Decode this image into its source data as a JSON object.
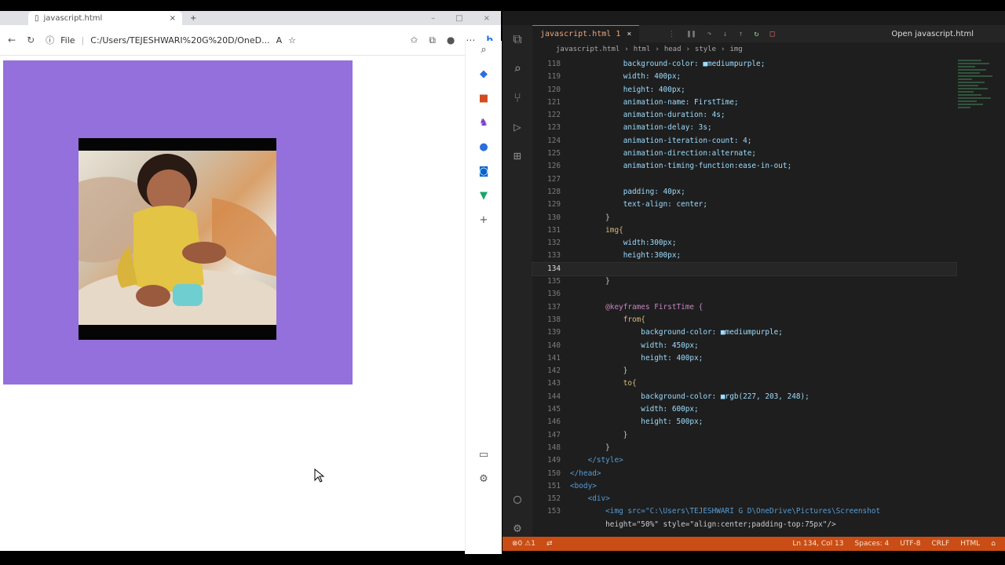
{
  "browser": {
    "tab_title": "javascript.html",
    "tab_close": "×",
    "new_tab": "+",
    "address_prefix": "File",
    "address_url": "C:/Users/TEJESHWARI%20G%20D/OneD...",
    "page_bg": "#9370db"
  },
  "editor": {
    "tab_title": "javascript.html 1",
    "tab_close": "×",
    "open_button": "Open javascript.html",
    "breadcrumbs": [
      "javascript.html",
      "html",
      "head",
      "style",
      "img"
    ],
    "lines": [
      {
        "n": "118",
        "t": "            background-color: ■mediumpurple;"
      },
      {
        "n": "119",
        "t": "            width: 400px;"
      },
      {
        "n": "120",
        "t": "            height: 400px;"
      },
      {
        "n": "121",
        "t": "            animation-name: FirstTime;"
      },
      {
        "n": "122",
        "t": "            animation-duration: 4s;"
      },
      {
        "n": "123",
        "t": "            animation-delay: 3s;"
      },
      {
        "n": "124",
        "t": "            animation-iteration-count: 4;"
      },
      {
        "n": "125",
        "t": "            animation-direction:alternate;"
      },
      {
        "n": "126",
        "t": "            animation-timing-function:ease-in-out;"
      },
      {
        "n": "127",
        "t": ""
      },
      {
        "n": "128",
        "t": "            padding: 40px;"
      },
      {
        "n": "129",
        "t": "            text-align: center;"
      },
      {
        "n": "130",
        "t": "        }"
      },
      {
        "n": "131",
        "t": "        img{"
      },
      {
        "n": "132",
        "t": "            width:300px;"
      },
      {
        "n": "133",
        "t": "            height:300px;"
      },
      {
        "n": "134",
        "t": ""
      },
      {
        "n": "135",
        "t": "        }"
      },
      {
        "n": "136",
        "t": ""
      },
      {
        "n": "137",
        "t": "        @keyframes FirstTime {"
      },
      {
        "n": "138",
        "t": "            from{"
      },
      {
        "n": "139",
        "t": "                background-color: ■mediumpurple;"
      },
      {
        "n": "140",
        "t": "                width: 450px;"
      },
      {
        "n": "141",
        "t": "                height: 400px;"
      },
      {
        "n": "142",
        "t": "            }"
      },
      {
        "n": "143",
        "t": "            to{"
      },
      {
        "n": "144",
        "t": "                background-color: ■rgb(227, 203, 248);"
      },
      {
        "n": "145",
        "t": "                width: 600px;"
      },
      {
        "n": "146",
        "t": "                height: 500px;"
      },
      {
        "n": "147",
        "t": "            }"
      },
      {
        "n": "148",
        "t": "        }"
      },
      {
        "n": "149",
        "t": "    </style>"
      },
      {
        "n": "150",
        "t": "</head>"
      },
      {
        "n": "151",
        "t": "<body>"
      },
      {
        "n": "152",
        "t": "    <div>"
      },
      {
        "n": "153",
        "t": "        <img src=\"C:\\Users\\TEJESHWARI G D\\OneDrive\\Pictures\\Screenshot"
      },
      {
        "n": "",
        "t": "        height=\"50%\" style=\"align:center;padding-top:75px\"/>"
      }
    ],
    "active_line": "134"
  },
  "statusbar": {
    "problems": "⊗0 ⚠1",
    "position": "Ln 134, Col 13",
    "spaces": "Spaces: 4",
    "encoding": "UTF-8",
    "eol": "CRLF",
    "language": "HTML"
  },
  "colors": {
    "accent": "#c94d14",
    "editor_bg": "#1e1e1e",
    "mediumpurple": "#9370db"
  }
}
